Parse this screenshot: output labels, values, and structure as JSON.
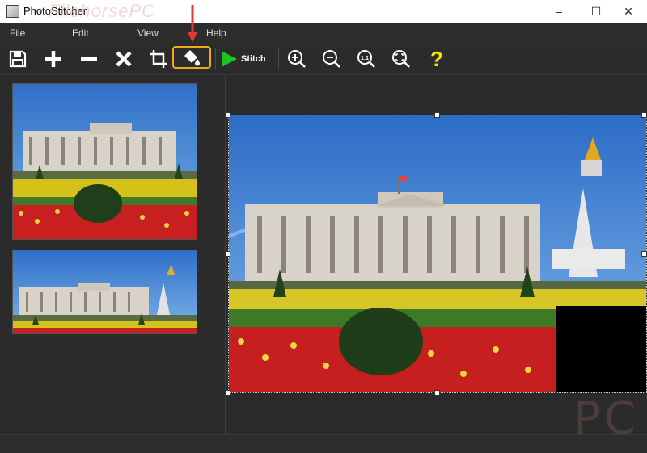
{
  "window": {
    "title": "PhotoStitcher",
    "watermark": "FilehorsePC",
    "controls": [
      "–",
      "☐",
      "✕"
    ]
  },
  "menu": {
    "items": [
      "File",
      "Edit",
      "View",
      "Help"
    ]
  },
  "toolbar": {
    "buttons": [
      "save-icon",
      "add-icon",
      "remove-icon",
      "delete-icon",
      "crop-icon",
      "fill-icon",
      "stitch-icon",
      "zoom-in-icon",
      "zoom-out-icon",
      "zoom-actual-icon",
      "zoom-fit-icon",
      "help-icon"
    ],
    "stitch_label": "Stitch",
    "zoom_actual_label": "1:1",
    "active_button": "fill-icon"
  },
  "colors": {
    "accent": "#f0a820",
    "arrow": "#e53935",
    "stitch_green": "#1ec21e",
    "help_yellow": "#f5e000"
  },
  "watermark_bottom": "PC"
}
